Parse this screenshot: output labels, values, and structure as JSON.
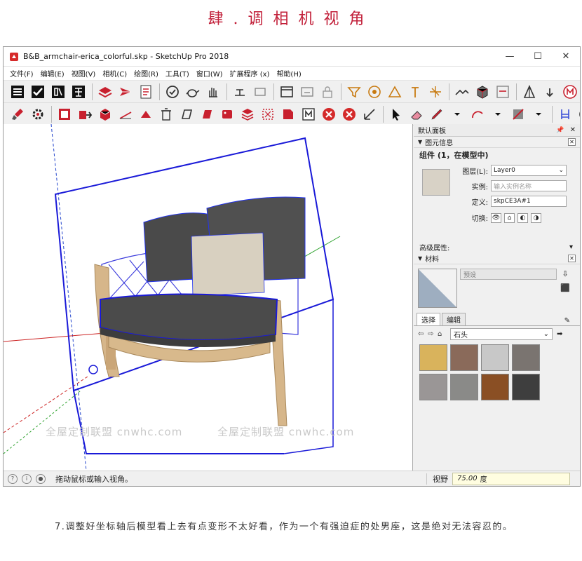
{
  "heading": "肆.调相机视角",
  "window": {
    "title": "B&B_armchair-erica_colorful.skp - SketchUp Pro 2018",
    "minimize": "—",
    "maximize": "☐",
    "close": "✕"
  },
  "menu": [
    "文件(F)",
    "编辑(E)",
    "视图(V)",
    "相机(C)",
    "绘图(R)",
    "工具(T)",
    "窗口(W)",
    "扩展程序 (x)",
    "帮助(H)"
  ],
  "viewport": {
    "watermarks": [
      "全屋定制联盟 cnwhc.com",
      "全屋定制联盟 cnwhc.com",
      "全屋定制联盟 cnwhc.com"
    ]
  },
  "tray": {
    "title": "默认面板",
    "pin": "📌",
    "close": "✕",
    "entity_info": {
      "header": "图元信息",
      "title": "组件 (1，在模型中)",
      "layer_label": "图层(L):",
      "layer_value": "Layer0",
      "instance_label": "实例:",
      "instance_placeholder": "输入实例名称",
      "definition_label": "定义:",
      "definition_value": "skpCE3A#1",
      "toggle_label": "切换:",
      "advanced_label": "高级属性:"
    },
    "materials": {
      "header": "材料",
      "name_placeholder": "预设",
      "tab_select": "选择",
      "tab_edit": "编辑",
      "library": "石头",
      "swatch_colors": [
        "#d9b35c",
        "#8a6a5a",
        "#c8c8c8",
        "#7a7470",
        "#9a9696",
        "#8a8a88",
        "#8a4f24",
        "#3e3e3e"
      ]
    }
  },
  "status": {
    "text": "拖动鼠标或输入视角。",
    "field_label": "视野",
    "field_value": "75.00",
    "field_unit": "度"
  },
  "caption": "7.调整好坐标轴后模型看上去有点变形不太好看，作为一个有强迫症的处男座，这是绝对无法容忍的。"
}
